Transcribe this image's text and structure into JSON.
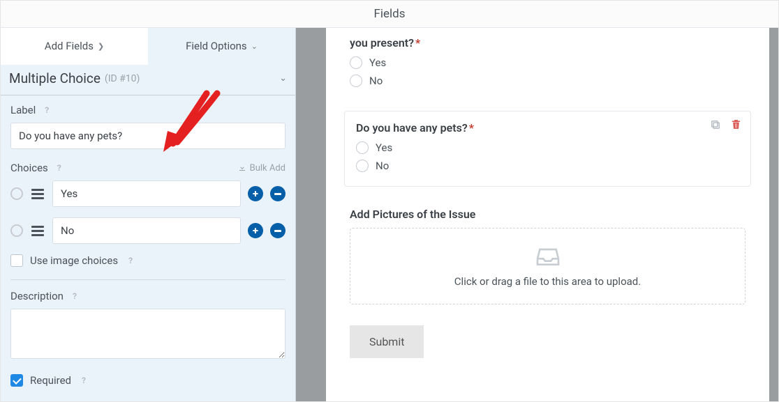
{
  "header": {
    "title": "Fields"
  },
  "tabs": {
    "add": "Add Fields",
    "options": "Field Options"
  },
  "section": {
    "title": "Multiple Choice",
    "id": "(ID #10)"
  },
  "label_field": {
    "label": "Label",
    "value": "Do you have any pets?"
  },
  "choices": {
    "label": "Choices",
    "bulk": "Bulk Add",
    "items": [
      "Yes",
      "No"
    ]
  },
  "image_choices": {
    "label": "Use image choices"
  },
  "description": {
    "label": "Description",
    "value": ""
  },
  "required": {
    "label": "Required",
    "checked": true
  },
  "preview": {
    "q1": {
      "label": "you present?",
      "options": [
        "Yes",
        "No"
      ]
    },
    "q2": {
      "label": "Do you have any pets?",
      "options": [
        "Yes",
        "No"
      ]
    },
    "upload": {
      "label": "Add Pictures of the Issue",
      "hint": "Click or drag a file to this area to upload."
    },
    "submit": "Submit"
  }
}
